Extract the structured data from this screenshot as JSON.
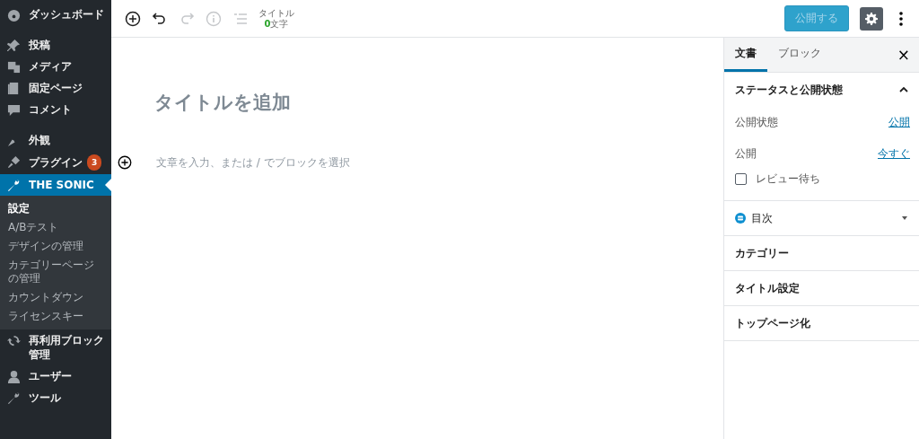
{
  "sidebar": {
    "items": [
      {
        "label": "ダッシュボード",
        "selected": false
      },
      {
        "label": "投稿",
        "selected": false
      },
      {
        "label": "メディア",
        "selected": false
      },
      {
        "label": "固定ページ",
        "selected": false
      },
      {
        "label": "コメント",
        "selected": false
      },
      {
        "label": "外観",
        "selected": false
      },
      {
        "label": "プラグイン",
        "selected": false,
        "badge": "3"
      },
      {
        "label": "THE SONIC",
        "selected": true,
        "submenu": [
          {
            "label": "設定",
            "selected": true
          },
          {
            "label": "A/Bテスト",
            "selected": false
          },
          {
            "label": "デザインの管理",
            "selected": false
          },
          {
            "label": "カテゴリーページの管理",
            "selected": false
          },
          {
            "label": "カウントダウン",
            "selected": false
          },
          {
            "label": "ライセンスキー",
            "selected": false
          }
        ]
      },
      {
        "label": "再利用ブロック管理",
        "selected": false
      },
      {
        "label": "ユーザー",
        "selected": false
      },
      {
        "label": "ツール",
        "selected": false
      }
    ]
  },
  "toolbar": {
    "tools": [
      {
        "kind": "add",
        "disabled": false
      },
      {
        "kind": "undo",
        "disabled": false
      },
      {
        "kind": "redo",
        "disabled": true
      },
      {
        "kind": "info",
        "disabled": true
      },
      {
        "kind": "outline",
        "disabled": true
      }
    ],
    "title_label": "タイトル",
    "count": "0",
    "count_unit": "文字",
    "publish_button": {
      "label": "公開する",
      "disabled": true
    },
    "settings_pressed": true
  },
  "editor": {
    "title_placeholder": "タイトルを追加",
    "block_placeholder": "文章を入力、または / でブロックを選択"
  },
  "panel": {
    "tabs": [
      {
        "label": "文書",
        "selected": true
      },
      {
        "label": "ブロック",
        "selected": false
      }
    ],
    "close": "×",
    "status_section": {
      "title": "ステータスと公開状態",
      "expanded": true,
      "rows": [
        {
          "label": "公開状態",
          "value": "公開"
        },
        {
          "label": "公開",
          "value": "今すぐ"
        }
      ],
      "checkbox": {
        "label": "レビュー待ち",
        "checked": false
      }
    },
    "sections": [
      {
        "title": "目次",
        "kind": "plugin"
      },
      {
        "title": "カテゴリー",
        "kind": "plain"
      },
      {
        "title": "タイトル設定",
        "kind": "plain"
      },
      {
        "title": "トップページ化",
        "kind": "plain"
      }
    ]
  }
}
